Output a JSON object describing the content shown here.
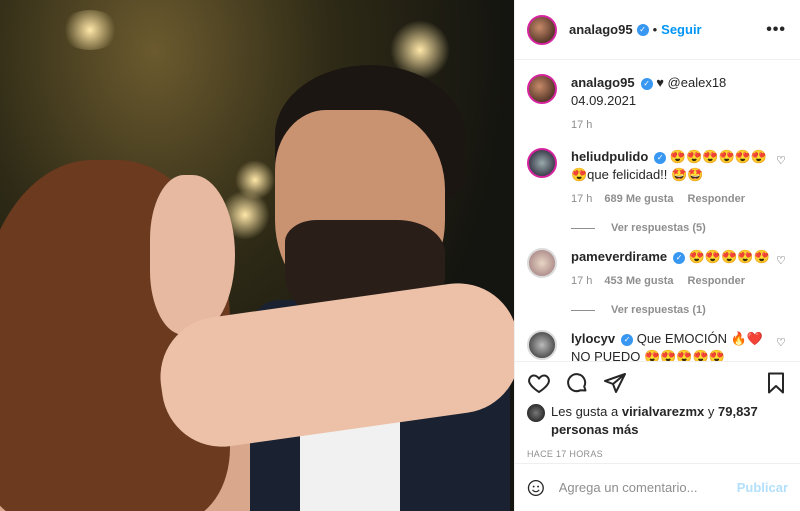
{
  "post": {
    "author": "analago95",
    "follow_label": "Seguir",
    "dot": "•",
    "more_label": "•••"
  },
  "caption": {
    "author": "analago95",
    "text": "♥ @ealex18 04.09.2021",
    "time": "17 h"
  },
  "comments": [
    {
      "user": "heliudpulido",
      "text": "😍😍😍😍😍😍😍que felicidad!! 🤩🤩",
      "time": "17 h",
      "likes": "689 Me gusta",
      "reply": "Responder",
      "view_replies": "Ver respuestas (5)"
    },
    {
      "user": "pameverdirame",
      "text": "😍😍😍😍😍",
      "time": "17 h",
      "likes": "453 Me gusta",
      "reply": "Responder",
      "view_replies": "Ver respuestas (1)"
    },
    {
      "user": "lylocyv",
      "text": "Que EMOCIÓN 🔥❤️NO PUEDO 😍😍😍😍😍"
    }
  ],
  "likes": {
    "prefix": "Les gusta a",
    "user": "virialvarezmx",
    "joiner": "y",
    "count": "79,837 personas más"
  },
  "timestamp": "HACE 17 HORAS",
  "add_comment": {
    "placeholder": "Agrega un comentario...",
    "publish": "Publicar"
  },
  "colors": {
    "accent": "#0095f6",
    "verified": "#3897f0",
    "publish_disabled": "#b2dffc"
  }
}
